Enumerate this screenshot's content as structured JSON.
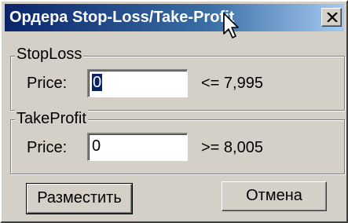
{
  "window": {
    "title": "Ордера Stop-Loss/Take-Profit",
    "close_icon": "close-x-icon"
  },
  "stoploss": {
    "group_label": "StopLoss",
    "price_label": "Price:",
    "price_value": "0",
    "limit_text": "<= 7,995"
  },
  "takeprofit": {
    "group_label": "TakeProfit",
    "price_label": "Price:",
    "price_value": "0",
    "limit_text": ">= 8,005"
  },
  "buttons": {
    "place_label": "Разместить",
    "cancel_label": "Отмена"
  },
  "colors": {
    "titlebar_start": "#0a246a",
    "titlebar_end": "#a6caf0",
    "dialog_face": "#d4d0c8",
    "selection": "#0a246a"
  }
}
